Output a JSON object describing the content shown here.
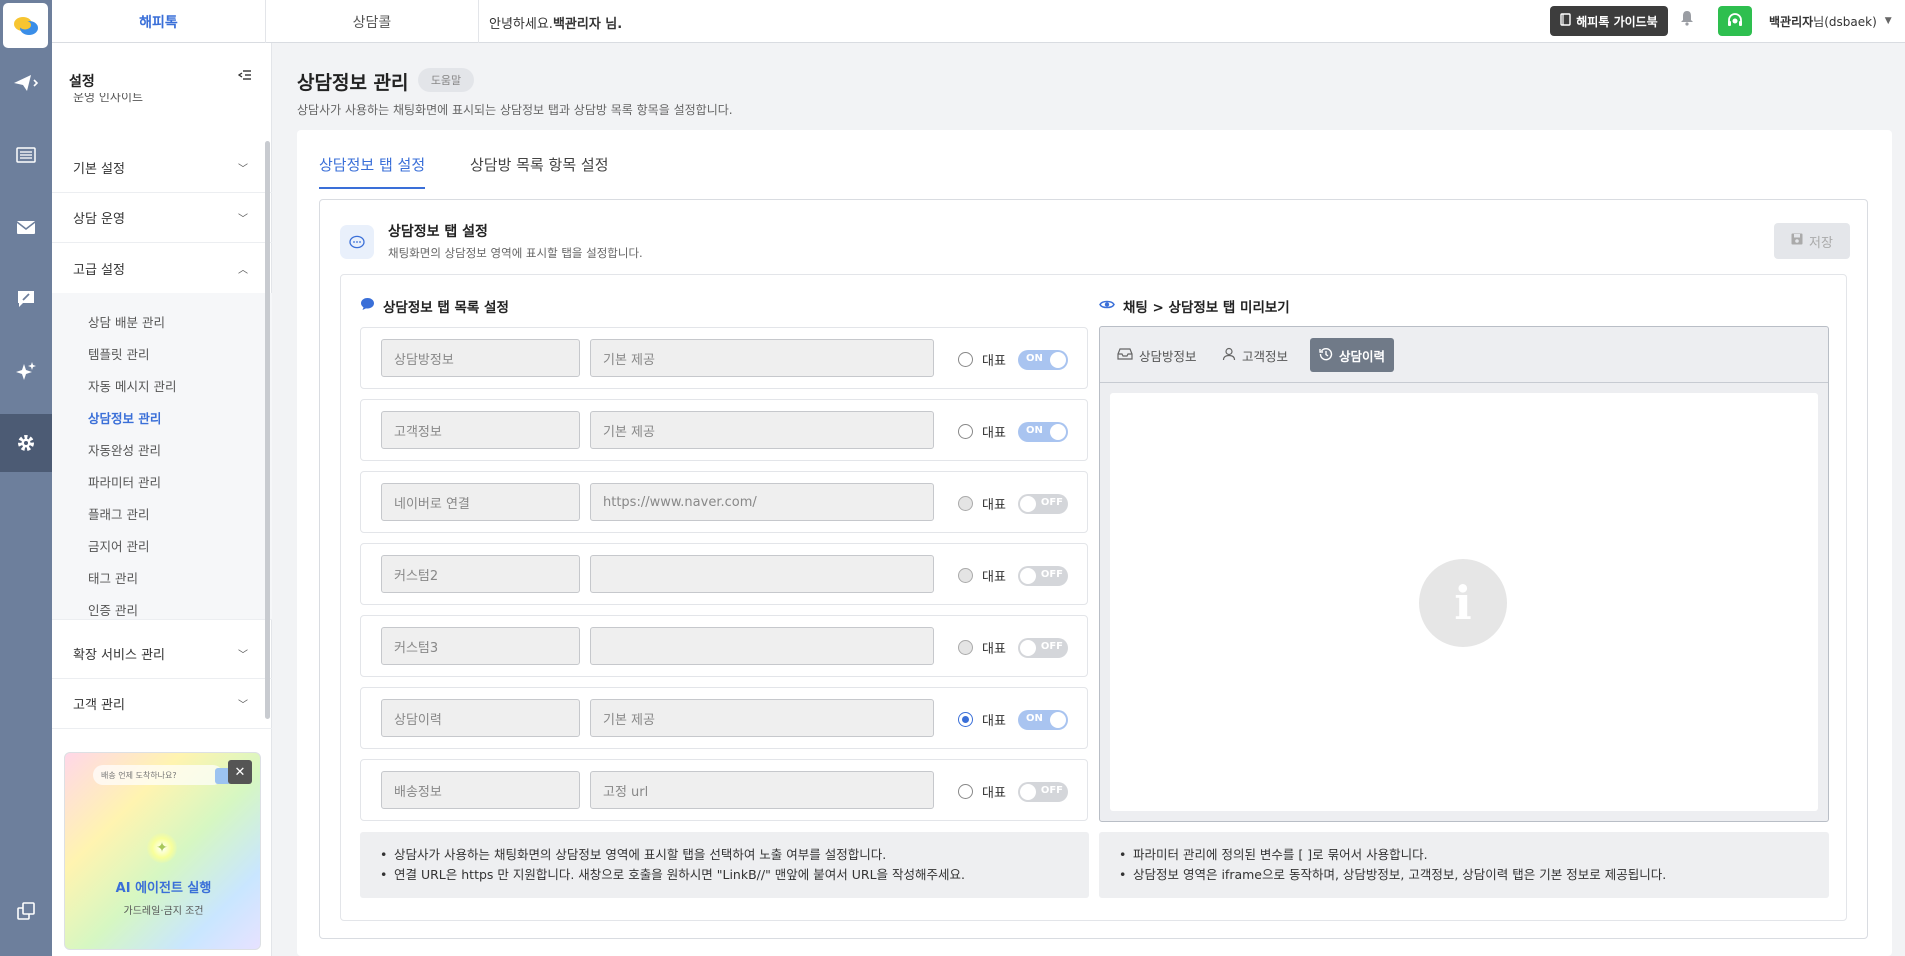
{
  "topbar": {
    "tabs": [
      "해피톡",
      "상담콜"
    ],
    "greeting_prefix": "안녕하세요.",
    "greeting_name": "백관리자 님.",
    "guide_label": "해피톡 가이드북",
    "user_name": "백관리자",
    "user_suffix": "님(dsbaek)"
  },
  "sidebar": {
    "title": "설정",
    "cut_item": "운영 인사이트",
    "sections": {
      "basic": "기본 설정",
      "operation": "상담 운영",
      "advanced": "고급 설정",
      "extension": "확장 서비스 관리",
      "customer": "고객 관리"
    },
    "sub_items": [
      "상담 배분 관리",
      "템플릿 관리",
      "자동 메시지 관리",
      "상담정보 관리",
      "자동완성 관리",
      "파라미터 관리",
      "플래그 관리",
      "금지어 관리",
      "태그 관리",
      "인증 관리"
    ],
    "active_item": "상담정보 관리"
  },
  "promo": {
    "question": "배송 언제 도착하나요?",
    "title": "AI 에이전트 실행",
    "subtitle": "가드레일·금지 조건",
    "close": "✕"
  },
  "page": {
    "title": "상담정보 관리",
    "help": "도움말",
    "description": "상담사가 사용하는 채팅화면에 표시되는 상담정보 탭과 상담방 목록 항목을 설정합니다.",
    "tabs": [
      "상담정보 탭 설정",
      "상담방 목록 항목 설정"
    ],
    "active_tab": "상담정보 탭 설정"
  },
  "section": {
    "title": "상담정보 탭 설정",
    "description": "채팅화면의 상담정보 영역에 표시할 탭을 설정합니다.",
    "save_label": "저장"
  },
  "tab_list": {
    "heading": "상담정보 탭 목록 설정",
    "rep_label": "대표",
    "rows": [
      {
        "name": "상담방정보",
        "url": "기본 제공",
        "url_is_placeholder": false,
        "representative": false,
        "toggle": "ON"
      },
      {
        "name": "고객정보",
        "url": "기본 제공",
        "url_is_placeholder": false,
        "representative": false,
        "toggle": "ON"
      },
      {
        "name": "네이버로 연결",
        "url": "https://www.naver.com/",
        "url_is_placeholder": false,
        "representative": false,
        "toggle": "OFF"
      },
      {
        "name": "커스텀2",
        "url": "",
        "url_is_placeholder": false,
        "representative": false,
        "toggle": "OFF"
      },
      {
        "name": "커스텀3",
        "url": "",
        "url_is_placeholder": false,
        "representative": false,
        "toggle": "OFF"
      },
      {
        "name": "상담이력",
        "url": "기본 제공",
        "url_is_placeholder": false,
        "representative": true,
        "toggle": "ON"
      },
      {
        "name": "배송정보",
        "url": "고정 url",
        "url_is_placeholder": false,
        "representative": false,
        "toggle": "OFF"
      }
    ]
  },
  "preview": {
    "heading": "채팅 > 상담정보 탭 미리보기",
    "tabs": [
      "상담방정보",
      "고객정보",
      "상담이력"
    ],
    "active_tab": "상담이력",
    "empty_icon": "info-icon"
  },
  "notes": {
    "left": [
      "상담사가 사용하는 채팅화면의 상담정보 영역에 표시할 탭을 선택하여 노출 여부를 설정합니다.",
      "연결 URL은 https 만 지원합니다. 새창으로 호출을 원하시면 \"LinkB//\" 맨앞에 붙여서 URL을 작성해주세요."
    ],
    "right": [
      "파라미터 관리에 정의된 변수를 [ ]로 묶어서 사용합니다.",
      "상담정보 영역은 iframe으로 동작하며, 상담방정보, 고객정보, 상담이력 탭은 기본 정보로 제공됩니다."
    ]
  },
  "colors": {
    "accent": "#3a6fd8",
    "rail": "#6d7f9c",
    "headset": "#2ebf4f",
    "toggle_on": "#a9c4f0",
    "toggle_off": "#d4d6da"
  }
}
